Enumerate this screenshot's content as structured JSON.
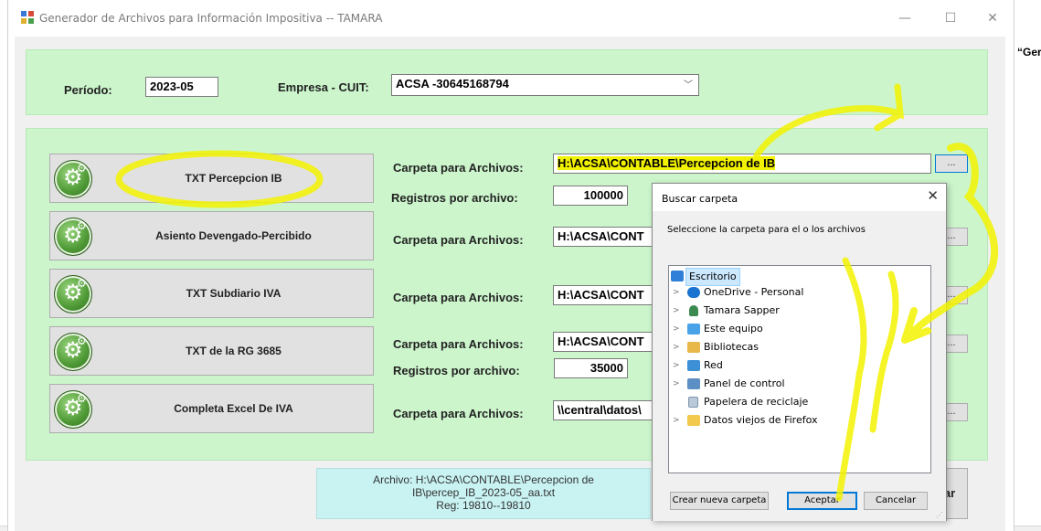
{
  "window": {
    "title": "Generador de Archivos para Información Impositiva   --  TAMARA",
    "minimize": "—",
    "maximize": "☐",
    "close": "✕"
  },
  "background": {
    "fragment_text": "“Ger"
  },
  "header": {
    "period_label": "Período:",
    "period_value": "2023-05",
    "company_label": "Empresa - CUIT:",
    "company_value": "ACSA  -30645168794"
  },
  "rows": [
    {
      "button": "TXT Percepcion IB",
      "folder_label": "Carpeta para Archivos:",
      "folder_value": "H:\\ACSA\\CONTABLE\\Percepcion de IB",
      "records_label": "Registros por archivo:",
      "records_value": "100000",
      "browse": "..."
    },
    {
      "button": "Asiento Devengado-Percibido",
      "folder_label": "Carpeta para Archivos:",
      "folder_value": "H:\\ACSA\\CONT",
      "browse": "..."
    },
    {
      "button": "TXT Subdiario IVA",
      "folder_label": "Carpeta para Archivos:",
      "folder_value": "H:\\ACSA\\CONT",
      "browse": "..."
    },
    {
      "button": "TXT de la RG 3685",
      "folder_label": "Carpeta para Archivos:",
      "folder_value": "H:\\ACSA\\CONT",
      "records_label": "Registros por archivo:",
      "records_value": "35000",
      "browse": "..."
    },
    {
      "button": "Completa Excel De IVA",
      "folder_label": "Carpeta para Archivos:",
      "folder_value": "\\\\central\\datos\\",
      "browse": "..."
    }
  ],
  "status": {
    "line1": "Archivo: H:\\ACSA\\CONTABLE\\Percepcion de",
    "line2": "IB\\percep_IB_2023-05_aa.txt",
    "line3": "Reg: 19810--19810"
  },
  "cancel_button": "elar",
  "dialog": {
    "title": "Buscar carpeta",
    "close": "✕",
    "description": "Seleccione la carpeta para el o los archivos",
    "tree": [
      {
        "label": "Escritorio",
        "icon": "desktop-icon",
        "selected": true
      },
      {
        "label": "OneDrive - Personal",
        "icon": "cloud-icon"
      },
      {
        "label": "Tamara Sapper",
        "icon": "user-icon"
      },
      {
        "label": "Este equipo",
        "icon": "computer-icon"
      },
      {
        "label": "Bibliotecas",
        "icon": "library-icon"
      },
      {
        "label": "Red",
        "icon": "network-icon"
      },
      {
        "label": "Panel de control",
        "icon": "control-panel-icon"
      },
      {
        "label": "Papelera de reciclaje",
        "icon": "recycle-bin-icon"
      },
      {
        "label": "Datos viejos de Firefox",
        "icon": "folder-icon"
      }
    ],
    "new_folder": "Crear nueva carpeta",
    "accept": "Aceptar",
    "cancel": "Cancelar"
  },
  "colors": {
    "panel_green": "#ccf5cc",
    "status_cyan": "#c9f2f2",
    "highlight_yellow": "#f2f200",
    "tree_selected": "#cce8ff"
  }
}
